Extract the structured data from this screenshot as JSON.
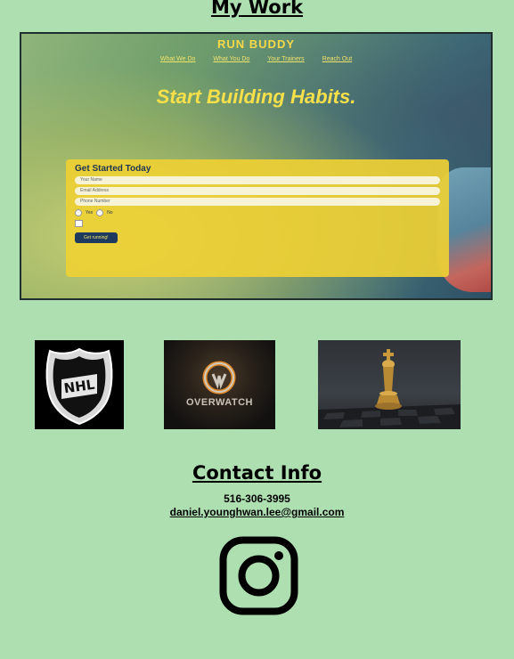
{
  "sections": {
    "work_title": "My Work",
    "contact_title": "Contact Info"
  },
  "featured_project": {
    "brand": "RUN BUDDY",
    "nav": [
      "What We Do",
      "What You Do",
      "Your Trainers",
      "Reach Out"
    ],
    "hero": "Start Building Habits.",
    "form": {
      "title": "Get Started Today",
      "name_placeholder": "Your Name",
      "email_placeholder": "Email Address",
      "phone_placeholder": "Phone Number",
      "radio_yes": "Yes",
      "radio_no": "No",
      "button": "Get running!"
    }
  },
  "projects": [
    {
      "name": "NHL",
      "icon": "nhl-shield-logo"
    },
    {
      "name": "OVERWATCH",
      "icon": "overwatch-logo"
    },
    {
      "name": "Chess",
      "icon": "chess-king-piece"
    }
  ],
  "contact": {
    "phone": "516-306-3995",
    "email": "daniel.younghwan.lee@gmail.com",
    "social_icon": "instagram-icon"
  },
  "colors": {
    "background": "#addfb0",
    "run_buddy_yellow": "#f7e04a"
  }
}
